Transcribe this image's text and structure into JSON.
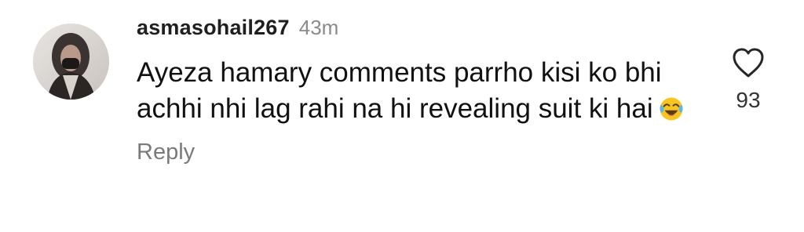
{
  "comment": {
    "username": "asmasohail267",
    "time_ago": "43m",
    "text": "Ayeza hamary comments parrho kisi ko bhi achhi nhi lag rahi na hi revealing suit ki hai",
    "emoji_icon": "face-with-tears-of-joy-icon",
    "reply_label": "Reply",
    "like_icon": "heart-outline-icon",
    "like_count": "93"
  }
}
